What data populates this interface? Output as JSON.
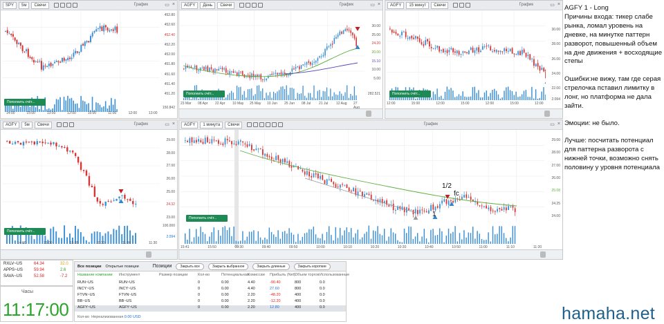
{
  "chart_common": {
    "type_label": "Свечи",
    "title": "График",
    "btn_label": "Пополнить счёт..."
  },
  "charts": {
    "spy": {
      "ticker": "SPY",
      "tf": "5м",
      "y": [
        "452.80",
        "452.60",
        "452.40",
        "452.20",
        "452.00",
        "451.80",
        "451.60",
        "451.40",
        "451.20"
      ],
      "price": "452.40",
      "x": [
        "14:00",
        "15:00",
        "13:00",
        "12:00",
        "15:00",
        "11:00",
        "12:00",
        "13:00"
      ],
      "vol": "150.842"
    },
    "agfy_day": {
      "ticker": "AGFY",
      "tf": "День",
      "y": [
        "30.00",
        "25.00",
        "24.20",
        "20.00",
        "15.10",
        "10.00",
        "5.00"
      ],
      "x": [
        "23 Mar",
        "08 Apr",
        "22 Apr",
        "10 May",
        "25 May",
        "10 Jun",
        "25 Jun",
        "08 Jul",
        "21 Jul",
        "12 Aug",
        "27 Aug"
      ],
      "vol": "282.521"
    },
    "agfy_15m": {
      "ticker": "AGFY",
      "tf": "15 минут",
      "y": [
        "30.00",
        "28.00",
        "26.00",
        "24.00",
        "22.00"
      ],
      "x": [
        "12:00",
        "15:00",
        "12:00",
        "15:00",
        "12:00",
        "15:00",
        "12:00"
      ],
      "vol": "2.094"
    },
    "agfy_5m_small": {
      "ticker": "AGFY",
      "tf": "5м",
      "y": [
        "29.00",
        "28.00",
        "27.00",
        "26.00",
        "25.00",
        "24.32",
        "23.00"
      ],
      "price": "24.32",
      "x": [
        "14:00",
        "15:00",
        "15:35",
        "10:30",
        "11:00",
        "11:30"
      ],
      "vol_top": "100.000",
      "vol": "2.094"
    },
    "agfy_1m": {
      "ticker": "AGFY",
      "tf": "1 минута",
      "y": [
        "29.00",
        "28.00",
        "27.00",
        "26.00",
        "25.08",
        "24.25",
        "24.00"
      ],
      "x": [
        "15:41",
        "15:50",
        "09:30",
        "09:40",
        "09:50",
        "10:00",
        "10:10",
        "10:20",
        "10:30",
        "10:40",
        "10:50",
        "11:00",
        "11:10",
        "11:20"
      ]
    }
  },
  "annotations": {
    "a1": "1",
    "a2": "1/2",
    "fc": "fc"
  },
  "notes": [
    "AGFY 1 - Long\nПричины входа: тикер слабе рынка, ломал уровень на дневке, на минутке паттерн разворот, повышенный объем на дне движения + восходящие степы",
    "Ошибки:не вижу, там где серая стрелочка пставил лимитку в лонг, но платформа не дала зайти.",
    "Эмоции: не было.",
    "Лучше: посчитать потенциал для паттерна разворота с нижней точки, возможно снять половину у уровня потенциала"
  ],
  "market_rows": [
    {
      "sym": "RXLV~US",
      "v1": "64.34",
      "v2": "32.0",
      "c2": "#e0a000"
    },
    {
      "sym": "APPS~US",
      "v1": "59.94",
      "v2": "2.6",
      "c2": "#2aa52a"
    },
    {
      "sym": "SAVA~US",
      "v1": "52.58",
      "v2": "-7.2",
      "c2": "#d22"
    }
  ],
  "clock": {
    "label": "Часы",
    "time": "11:17:00"
  },
  "positions": {
    "tab_all": "Все позиции",
    "tab_open": "Открытые позиции",
    "title": "Позиции",
    "btns": [
      "Закрыть все",
      "Закрыть выбранное",
      "Закрыть длинные",
      "Закрыть короткие"
    ],
    "headers": [
      "Название компании",
      "Инструмент",
      "Размер позиции",
      "Кол-во",
      "Потенциальная",
      "Комиссии",
      "Прибыль (Net)",
      "Объем торгов",
      "Использованные"
    ],
    "rows": [
      {
        "name": "RUN~US",
        "inst": "RUN~US",
        "qty": "0",
        "pot": "0.00",
        "com": "4.40",
        "pnl": "-90.40",
        "vol": "800",
        "used": "0.0",
        "pc": "#d22"
      },
      {
        "name": "INCY~US",
        "inst": "INCY~US",
        "qty": "0",
        "pot": "0.00",
        "com": "4.40",
        "pnl": "27.60",
        "vol": "800",
        "used": "0.0",
        "pc": "#1f6fd0"
      },
      {
        "name": "FTVN~US",
        "inst": "FTVN~US",
        "qty": "0",
        "pot": "0.00",
        "com": "2.20",
        "pnl": "-48.20",
        "vol": "400",
        "used": "0.0",
        "pc": "#d22"
      },
      {
        "name": "BB~US",
        "inst": "BB~US",
        "qty": "0",
        "pot": "0.00",
        "com": "2.20",
        "pnl": "-12.20",
        "vol": "400",
        "used": "0.0",
        "pc": "#d22"
      },
      {
        "name": "AGFY~US",
        "inst": "AGFY~US",
        "qty": "0",
        "pot": "0.00",
        "com": "2.20",
        "pnl": "12.80",
        "vol": "400",
        "used": "0.0",
        "pc": "#1f6fd0"
      }
    ],
    "footer_label": "Кол-во",
    "footer_label2": "Нереализованная",
    "footer_value": "0.00 USD"
  },
  "watermark": "hamaha.net"
}
